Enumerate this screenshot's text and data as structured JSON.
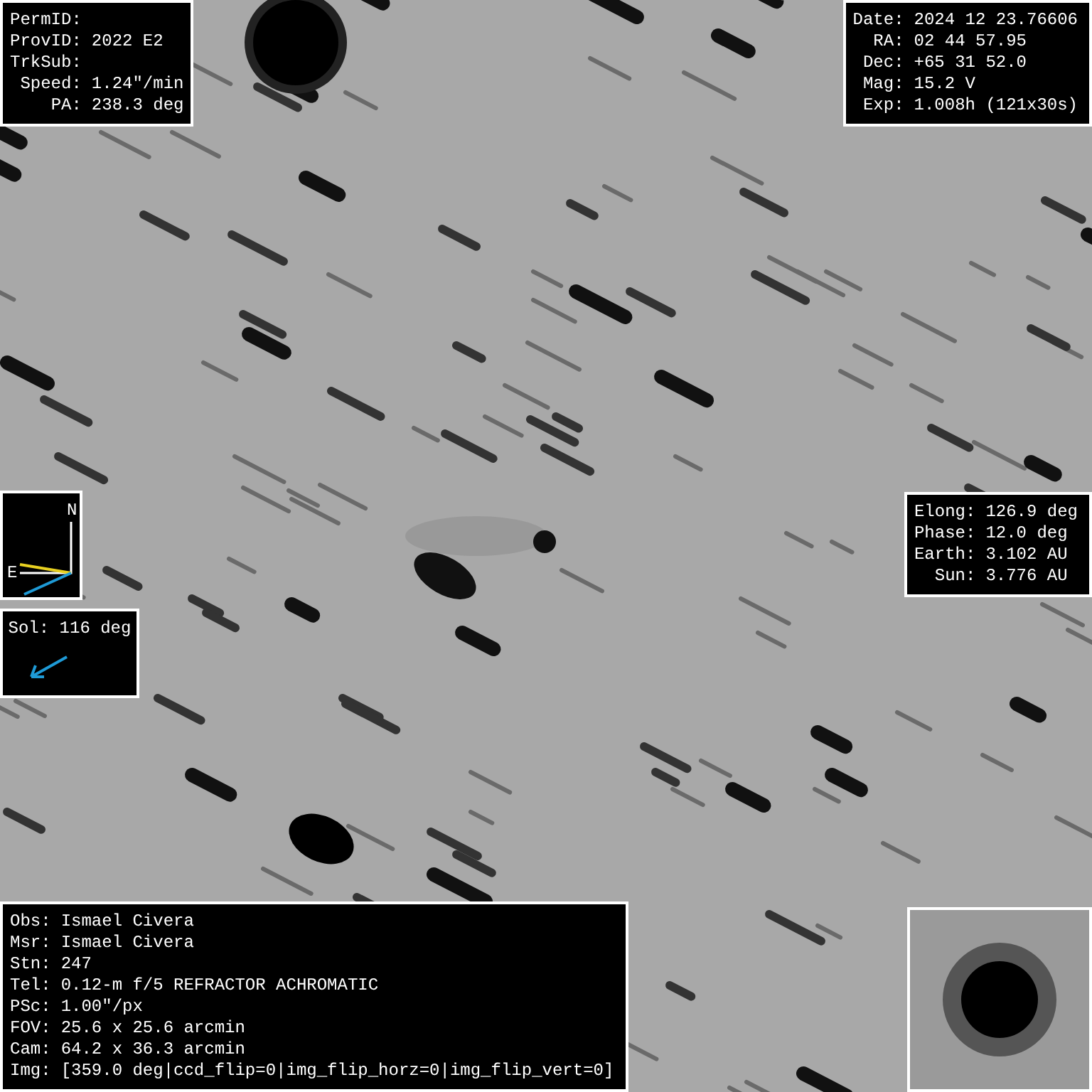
{
  "target_panel": {
    "rows": [
      {
        "label": "PermID:",
        "value": ""
      },
      {
        "label": "ProvID:",
        "value": "2022 E2"
      },
      {
        "label": "TrkSub:",
        "value": ""
      },
      {
        "label": "Speed:",
        "value": "1.24\"/min"
      },
      {
        "label": "PA:",
        "value": "238.3 deg"
      }
    ]
  },
  "observation_panel": {
    "rows": [
      {
        "label": "Date:",
        "value": "2024 12 23.76606"
      },
      {
        "label": "RA:",
        "value": "02 44 57.95"
      },
      {
        "label": "Dec:",
        "value": "+65 31 52.0"
      },
      {
        "label": "Mag:",
        "value": "15.2 V"
      },
      {
        "label": "Exp:",
        "value": "1.008h (121x30s)"
      }
    ]
  },
  "compass": {
    "north_label": "N",
    "east_label": "E"
  },
  "geometry_panel": {
    "rows": [
      {
        "label": "Elong:",
        "value": "126.9 deg"
      },
      {
        "label": "Phase:",
        "value": "12.0 deg"
      },
      {
        "label": "Earth:",
        "value": "3.102 AU"
      },
      {
        "label": "Sun:",
        "value": "3.776 AU"
      }
    ]
  },
  "sun_panel": {
    "text": "Sol: 116 deg"
  },
  "observer_panel": {
    "rows": [
      {
        "label": "Obs:",
        "value": "Ismael Civera"
      },
      {
        "label": "Msr:",
        "value": "Ismael Civera"
      },
      {
        "label": "Stn:",
        "value": "247"
      },
      {
        "label": "Tel:",
        "value": "0.12-m f/5 REFRACTOR ACHROMATIC"
      },
      {
        "label": "PSc:",
        "value": "1.00\"/px"
      },
      {
        "label": "FOV:",
        "value": "25.6 x 25.6 arcmin"
      },
      {
        "label": "Cam:",
        "value": "64.2 x 36.3 arcmin"
      },
      {
        "label": "Img:",
        "value": "[359.0 deg|ccd_flip=0|img_flip_horz=0|img_flip_vert=0]"
      }
    ]
  }
}
